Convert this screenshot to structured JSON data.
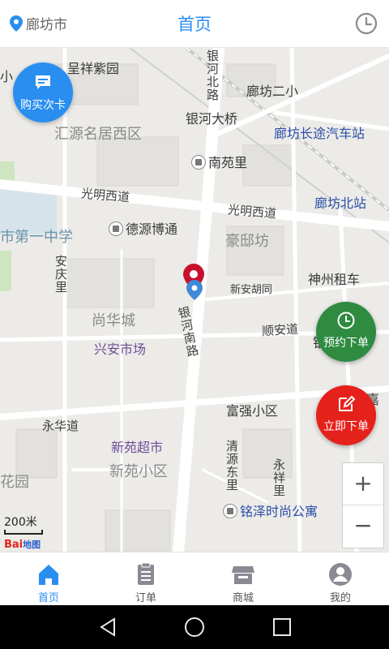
{
  "header": {
    "city": "廊坊市",
    "title": "首页",
    "accent": "#2a8ef0"
  },
  "map": {
    "scale_label": "200米",
    "logo_text": "Bai",
    "logo_suffix": "地图",
    "labels": {
      "chengxiangziyuan": "呈祥紫园",
      "yinhebeilu": "银河北路",
      "langfangerxiao": "廊坊二小",
      "yinhedaqiao": "银河大桥",
      "huiyuan": "汇源名居西区",
      "changtu": "廊坊长途汽车站",
      "nanyuanli": "南苑里",
      "guangmingxidao_1": "光明西道",
      "guangmingxidao_2": "光明西道",
      "beizhan": "廊坊北站",
      "diyizhongxue": "市第一中学",
      "deyuanbotong": "德源博通",
      "haoqifang": "豪邸坊",
      "anqingli": "安庆里",
      "shenzhouzuche": "神州租车",
      "xinanhutong": "新安胡同",
      "shanghuacheng": "尚华城",
      "yinhenanlu": "银河南路",
      "shunandao": "顺安道",
      "xinganshichang": "兴安市场",
      "fuqiangxiaoqu": "富强小区",
      "yonghuadao": "永华道",
      "xinyuanchaoshi": "新苑超市",
      "xinyuanxiaoqu": "新苑小区",
      "qingyuandongli": "清源东里",
      "yongxiangli": "永祥里",
      "huayuan": "花园",
      "mingze": "铭泽时尚公寓",
      "jia": "嘉",
      "yin": "银",
      "xiao": "小"
    },
    "buttons": {
      "buy_card": "购买次卡",
      "reserve": "预约下单",
      "order_now": "立即下单",
      "zoom_in": "+",
      "zoom_out": "−"
    },
    "colors": {
      "reserve": "#2e8b40",
      "order_now": "#e5211c",
      "buy_card": "#2a8ef0"
    }
  },
  "nav": {
    "items": [
      {
        "label": "首页",
        "icon": "home-icon",
        "active": true
      },
      {
        "label": "订单",
        "icon": "clipboard-icon",
        "active": false
      },
      {
        "label": "商城",
        "icon": "store-icon",
        "active": false
      },
      {
        "label": "我的",
        "icon": "user-icon",
        "active": false
      }
    ]
  }
}
